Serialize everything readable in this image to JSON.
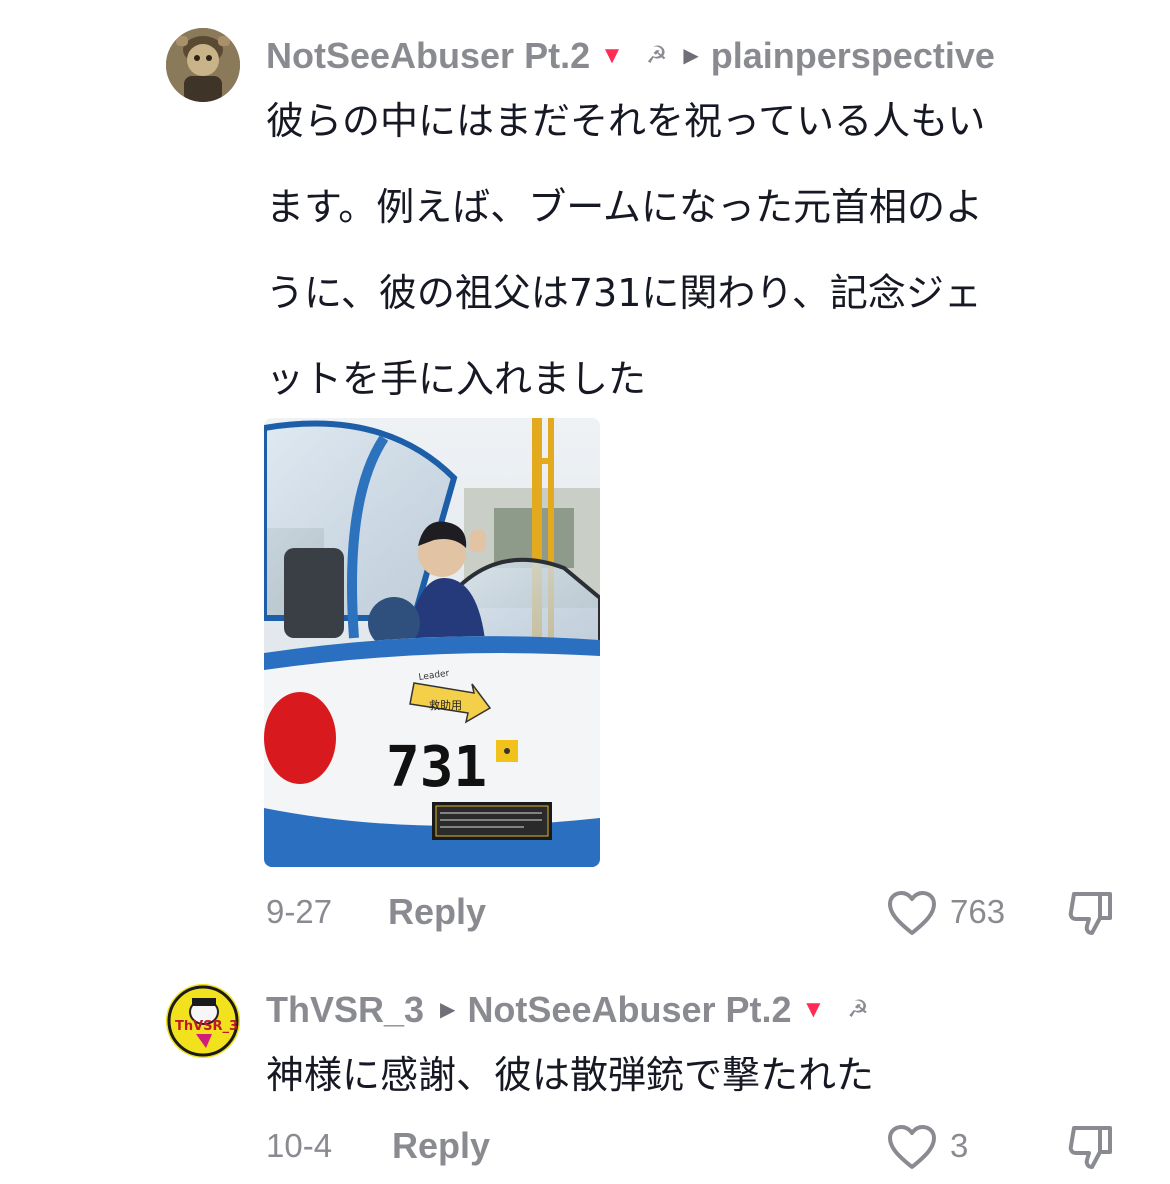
{
  "comments": [
    {
      "username": "NotSeeAbuser Pt.2",
      "reply_to": "plainperspective",
      "text_lines": [
        "彼らの中にはまだそれを祝っている人もい",
        "ます。例えば、ブームになった元首相のよ",
        "うに、彼の祖父は731に関わり、記念ジェ",
        "ットを手に入れました"
      ],
      "image": {
        "jet_number": "731",
        "jet_label": "Leader",
        "rescue_label": "救助用"
      },
      "date": "9-27",
      "reply_label": "Reply",
      "likes": "763",
      "avatar_icon": "character-avatar-icon"
    },
    {
      "username": "ThVSR_3",
      "reply_to": "NotSeeAbuser Pt.2",
      "text_lines": [
        "神様に感謝、彼は散弾銃で撃たれた"
      ],
      "date": "10-4",
      "reply_label": "Reply",
      "likes": "3",
      "avatar_icon": "yellow-logo-avatar-icon"
    }
  ],
  "colors": {
    "muted_text": "#8a8b91",
    "body_text": "#161823",
    "accent_red": "#fe2c55"
  }
}
